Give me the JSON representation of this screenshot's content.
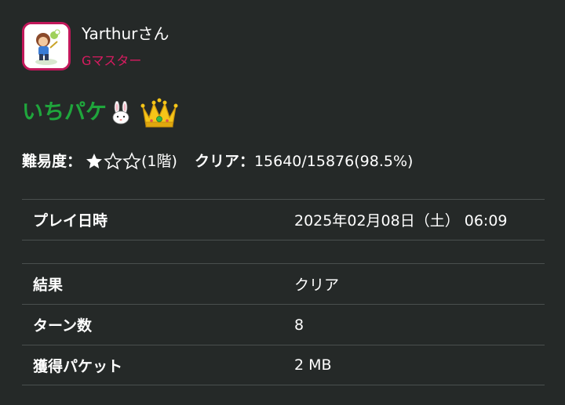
{
  "user": {
    "name": "Yarthurさん",
    "rank": "Gマスター"
  },
  "stage": {
    "name": "いちパケ"
  },
  "stats": {
    "difficulty_label": "難易度：",
    "difficulty_rating": 1,
    "difficulty_max": 3,
    "difficulty_suffix": "(1階)",
    "clear_label": "クリア：",
    "clear_value": "15640/15876(98.5%)"
  },
  "table": {
    "playtime_label": "プレイ日時",
    "playtime_value": "2025年02月08日（土） 06:09",
    "rows": [
      {
        "label": "結果",
        "value": "クリア"
      },
      {
        "label": "ターン数",
        "value": "8"
      },
      {
        "label": "獲得パケット",
        "value": "2 MB"
      }
    ]
  },
  "colors": {
    "background": "#252928",
    "stage_name": "#1fa63c",
    "rank": "#d81b60",
    "avatar_border": "#c2185b"
  },
  "icons": [
    "avatar",
    "rabbit-icon",
    "crown-icon",
    "star-filled-icon",
    "star-outline-icon"
  ]
}
